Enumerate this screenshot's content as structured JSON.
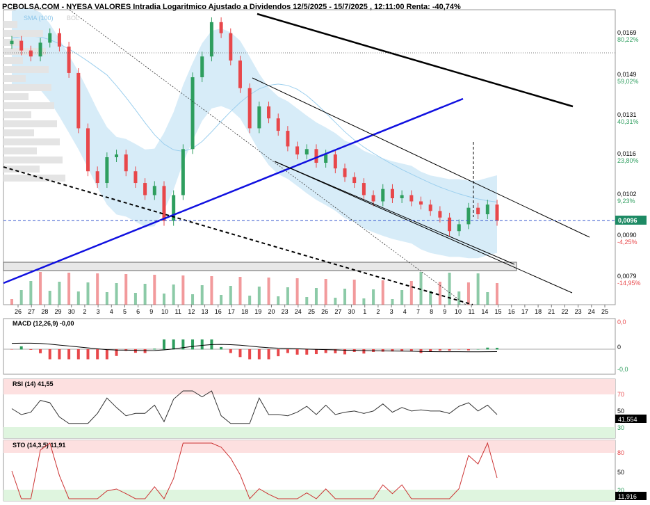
{
  "header": {
    "title": "PCBOLSA.COM - NYESA VALORES Intradia Logaritmico Ajustado a Dividendos 12/5/2025 - 15/7/2025 , 12:11:00 Renta: -40,74%",
    "sma_label": "SMA (100)",
    "bol_label": "BOL"
  },
  "colors": {
    "up": "#2e9e5e",
    "down": "#e8474a",
    "band": "#d7ecf8",
    "trend_blue": "#1010e0"
  },
  "chart_data": [
    {
      "type": "candlestick",
      "name": "price",
      "scale": "log",
      "x_ticks": [
        "26",
        "27",
        "28",
        "29",
        "30",
        "2",
        "3",
        "4",
        "5",
        "6",
        "9",
        "10",
        "11",
        "12",
        "13",
        "16",
        "17",
        "18",
        "19",
        "20",
        "23",
        "24",
        "25",
        "26",
        "27",
        "30",
        "1",
        "2",
        "3",
        "4",
        "7",
        "8",
        "9",
        "10",
        "11",
        "14",
        "15",
        "16",
        "17",
        "18",
        "21",
        "22",
        "23",
        "24",
        "25"
      ],
      "y_ticks": [
        {
          "price": "0,0169",
          "pct": "80,22%"
        },
        {
          "price": "0,0149",
          "pct": "59,02%"
        },
        {
          "price": "0,0131",
          "pct": "40,31%"
        },
        {
          "price": "0,0116",
          "pct": "23,80%"
        },
        {
          "price": "0,0102",
          "pct": "9,23%"
        },
        {
          "price": "0,0090",
          "pct": "-4,25%"
        },
        {
          "price": "0,0079",
          "pct": "-14,95%"
        }
      ],
      "last_price": "0,0096",
      "ylim": [
        0.0074,
        0.0185
      ],
      "closes": [
        0.0168,
        0.0163,
        0.016,
        0.0167,
        0.0172,
        0.0165,
        0.0152,
        0.0128,
        0.0112,
        0.0108,
        0.0117,
        0.0118,
        0.0112,
        0.0108,
        0.0104,
        0.0107,
        0.0096,
        0.0104,
        0.012,
        0.015,
        0.016,
        0.0178,
        0.0172,
        0.0158,
        0.0145,
        0.0128,
        0.0137,
        0.0132,
        0.0127,
        0.0121,
        0.0118,
        0.012,
        0.0115,
        0.0118,
        0.0113,
        0.011,
        0.0108,
        0.0104,
        0.0102,
        0.0106,
        0.0103,
        0.0104,
        0.0102,
        0.0101,
        0.0099,
        0.0097,
        0.0093,
        0.0095,
        0.01,
        0.0098,
        0.0101,
        0.0096
      ]
    },
    {
      "type": "line",
      "name": "MACD (12,26,9)",
      "value": "-0,00",
      "y_ticks": [
        "0,0",
        "0",
        "-0,0"
      ]
    },
    {
      "type": "line",
      "name": "RSI (14)",
      "value": "41,55",
      "last": "41,554",
      "y_ticks": [
        "70",
        "50",
        "30"
      ]
    },
    {
      "type": "line",
      "name": "STO (14,3,5)",
      "value": "11,91",
      "last": "11,916",
      "y_ticks": [
        "80",
        "50",
        "20"
      ]
    }
  ]
}
